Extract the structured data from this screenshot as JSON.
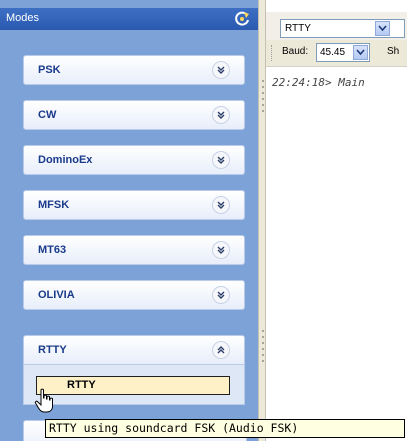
{
  "modes_pane": {
    "title": "Modes",
    "header_icon": "refresh-icon",
    "items": [
      {
        "label": "PSK",
        "icon": "chevron-down-icon"
      },
      {
        "label": "CW",
        "icon": "chevron-down-icon"
      },
      {
        "label": "DominoEx",
        "icon": "chevron-down-icon"
      },
      {
        "label": "MFSK",
        "icon": "chevron-down-icon"
      },
      {
        "label": "MT63",
        "icon": "chevron-down-icon"
      },
      {
        "label": "OLIVIA",
        "icon": "chevron-down-icon"
      },
      {
        "label": "RTTY",
        "icon": "chevron-up-icon",
        "expanded": true
      }
    ],
    "rtty_submode": "RTTY"
  },
  "toolbar": {
    "mode_select_value": "RTTY",
    "baud_label": "Baud:",
    "baud_value": "45.45",
    "shift_label": "Sh"
  },
  "log": {
    "line": "22:24:18> Main"
  },
  "tooltip": {
    "text": "RTTY using soundcard FSK (Audio FSK)"
  },
  "colors": {
    "pane_background": "#7da2d8",
    "header": "#2a5ab0",
    "item_text": "#1a3a8a",
    "highlight": "#fff1c7",
    "tooltip_bg": "#ffffe1"
  }
}
